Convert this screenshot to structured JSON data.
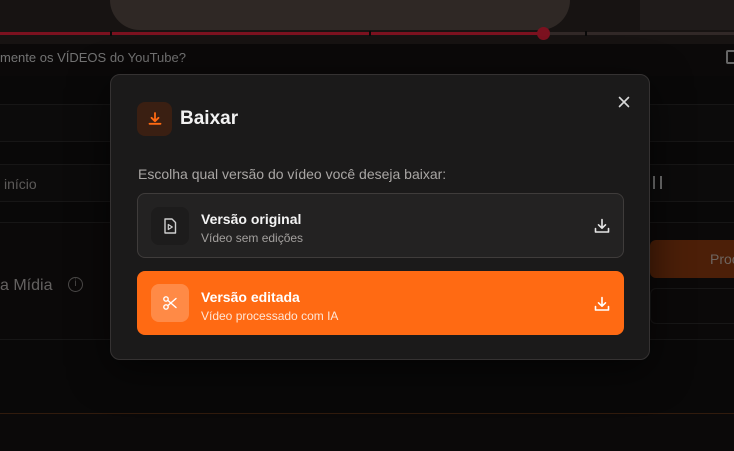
{
  "background": {
    "video_title": "mente os VÍDEOS do YouTube?",
    "field_label": "início",
    "media_label": "a Mídia",
    "info_icon": "i",
    "process_button_label": "Proc",
    "playback_progress": 0.74,
    "accent_color": "#e0203a"
  },
  "modal": {
    "title": "Baixar",
    "header_icon": "download-icon",
    "subtitle": "Escolha qual versão do vídeo você deseja baixar:",
    "options": [
      {
        "title": "Versão original",
        "description": "Vídeo sem edições",
        "icon": "video-file-icon",
        "selected": false
      },
      {
        "title": "Versão editada",
        "description": "Vídeo processado com IA",
        "icon": "scissors-icon",
        "selected": true
      }
    ],
    "accent_color": "#ff6a13"
  }
}
